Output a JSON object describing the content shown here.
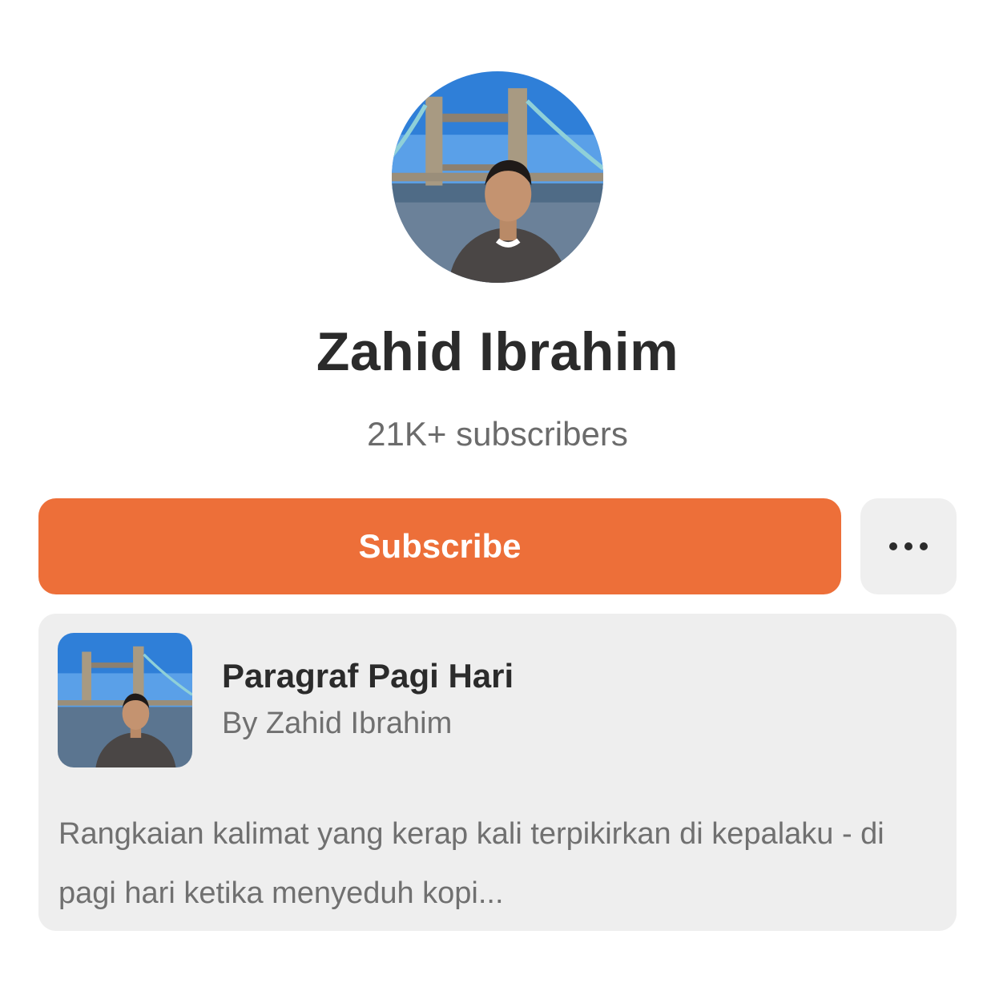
{
  "profile": {
    "name": "Zahid Ibrahim",
    "subscribers": "21K+ subscribers"
  },
  "actions": {
    "subscribe_label": "Subscribe",
    "more_icon": "more-horizontal-icon"
  },
  "publication": {
    "title": "Paragraf Pagi Hari",
    "author": "By Zahid Ibrahim",
    "description": "Rangkaian kalimat yang kerap kali terpikirkan di kepalaku - di pagi hari ketika menyeduh kopi..."
  },
  "colors": {
    "accent": "#ED6F39",
    "card_background": "#EEEEEE",
    "text_primary": "#2B2B2B",
    "text_secondary": "#707070"
  }
}
